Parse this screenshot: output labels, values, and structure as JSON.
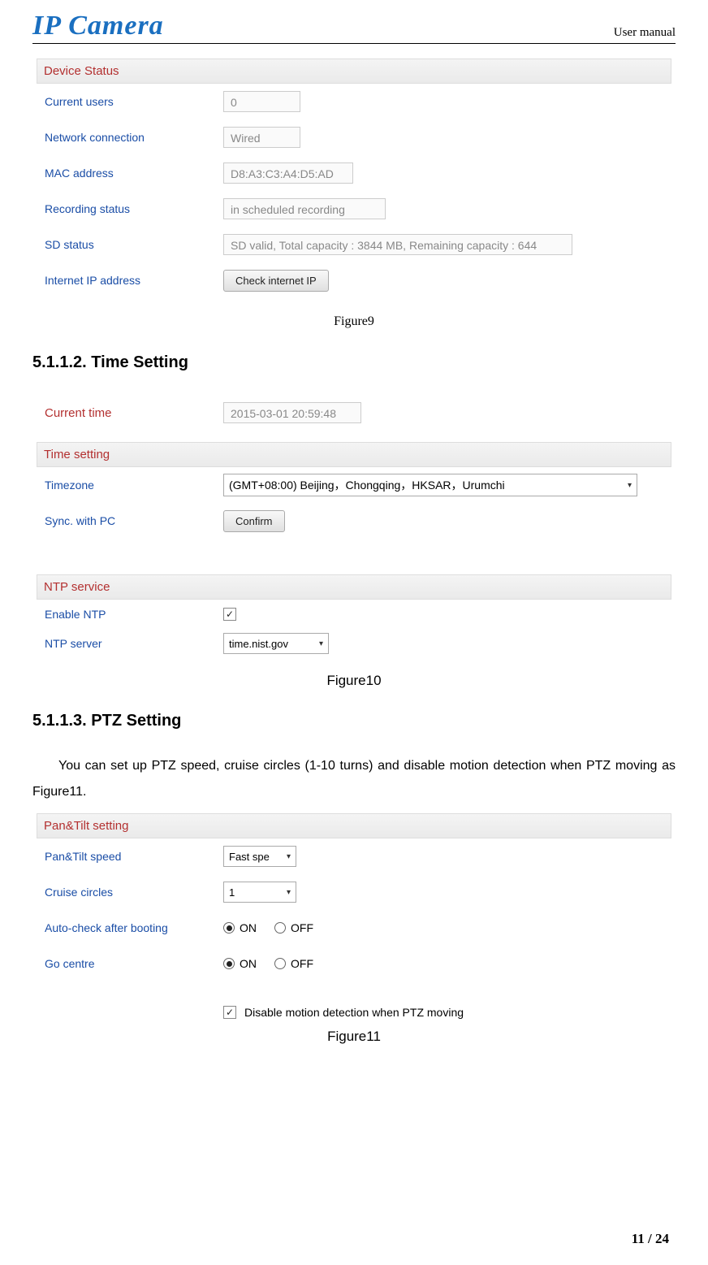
{
  "header": {
    "logo": "IP Camera",
    "right": "User manual"
  },
  "device_status": {
    "title": "Device Status",
    "rows": {
      "current_users_label": "Current users",
      "current_users_value": "0",
      "network_label": "Network connection",
      "network_value": "Wired",
      "mac_label": "MAC address",
      "mac_value": "D8:A3:C3:A4:D5:AD",
      "recording_label": "Recording status",
      "recording_value": "in scheduled recording",
      "sd_label": "SD status",
      "sd_value": "SD valid, Total capacity : 3844 MB, Remaining capacity : 644",
      "ip_label": "Internet IP address",
      "ip_button": "Check internet IP"
    }
  },
  "figure9": "Figure9",
  "sec_time_h": "5.1.1.2. Time Setting",
  "time_setting": {
    "current_time_title": "Current time",
    "current_time_value": "2015-03-01 20:59:48",
    "time_setting_title": "Time setting",
    "tz_label": "Timezone",
    "tz_value": "(GMT+08:00) Beijing，Chongqing，HKSAR，Urumchi",
    "sync_label": "Sync. with PC",
    "sync_button": "Confirm",
    "ntp_title": "NTP service",
    "ntp_enable_label": "Enable NTP",
    "ntp_server_label": "NTP server",
    "ntp_server_value": "time.nist.gov"
  },
  "figure10": "Figure10",
  "sec_ptz_h": "5.1.1.3. PTZ Setting",
  "ptz_body": "You can set up PTZ speed, cruise circles (1-10 turns) and disable motion detection when PTZ moving as Figure11.",
  "ptz": {
    "title": "Pan&Tilt setting",
    "speed_label": "Pan&Tilt speed",
    "speed_value": "Fast spe",
    "cruise_label": "Cruise circles",
    "cruise_value": "1",
    "auto_label": "Auto-check after booting",
    "go_label": "Go centre",
    "on": "ON",
    "off": "OFF",
    "disable_label": "Disable motion detection when PTZ moving"
  },
  "figure11": "Figure11",
  "page_number": "11 / 24"
}
